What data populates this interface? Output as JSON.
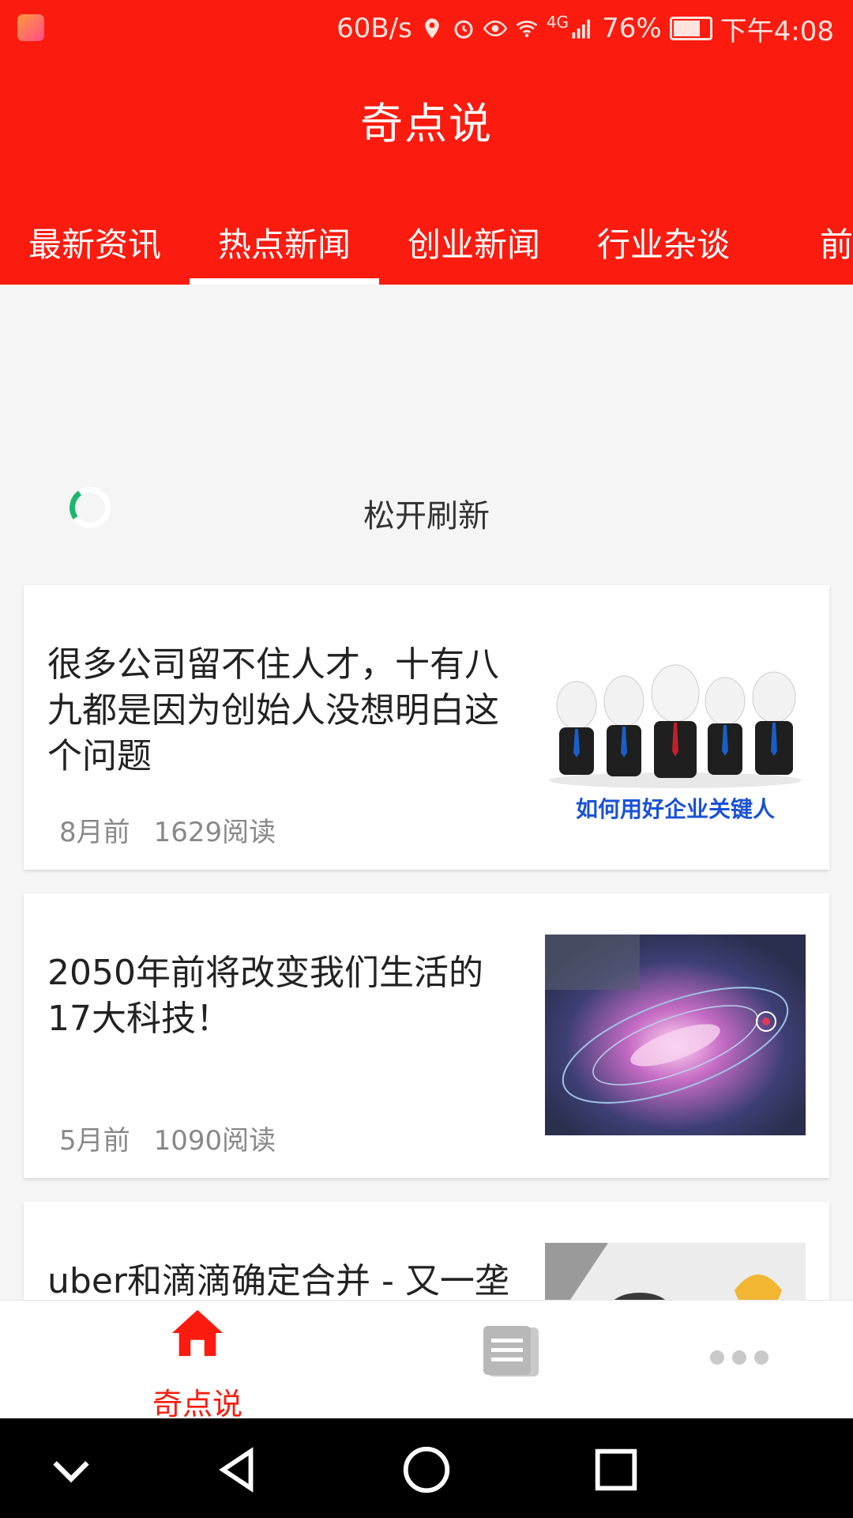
{
  "status_bar": {
    "net_speed": "60B/s",
    "network_type": "4G",
    "battery_percent": "76%",
    "time": "下午4:08",
    "battery_level": 0.76
  },
  "app_bar": {
    "title": "奇点说"
  },
  "tabs": [
    {
      "label": "最新资讯",
      "active": false
    },
    {
      "label": "热点新闻",
      "active": true
    },
    {
      "label": "创业新闻",
      "active": false
    },
    {
      "label": "行业杂谈",
      "active": false
    },
    {
      "label": "前沿",
      "active": false
    }
  ],
  "refresh": {
    "text": "松开刷新"
  },
  "articles": [
    {
      "headline": "很多公司留不住人才，十有八九都是因为创始人没想明白这个问题",
      "age": "8月前",
      "reads": "1629阅读",
      "thumb_caption": "如何用好企业关键人"
    },
    {
      "headline": "2050年前将改变我们生活的17大科技！",
      "age": "5月前",
      "reads": "1090阅读"
    },
    {
      "headline": "uber和滴滴确定合并 - 又一垄"
    }
  ],
  "bottom_nav": {
    "home_label": "奇点说"
  },
  "colors": {
    "brand_red": "#fb1b0f",
    "spinner_green": "#1cb66e"
  }
}
